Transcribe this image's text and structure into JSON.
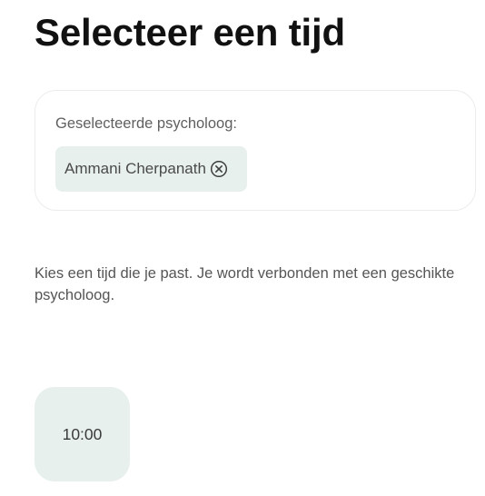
{
  "header": {
    "title": "Selecteer een tijd"
  },
  "selection": {
    "label": "Geselecteerde psycholoog:",
    "psychologist": "Ammani Cherpanath",
    "remove_icon": "close-circle-icon"
  },
  "helper": {
    "text": "Kies een tijd die je past. Je wordt verbonden met een geschikte psycholoog."
  },
  "time_slots": [
    {
      "label": "10:00"
    }
  ],
  "colors": {
    "chip_background": "#e7f0ec",
    "slot_background": "#e7f0ec",
    "card_border": "#ececec"
  }
}
